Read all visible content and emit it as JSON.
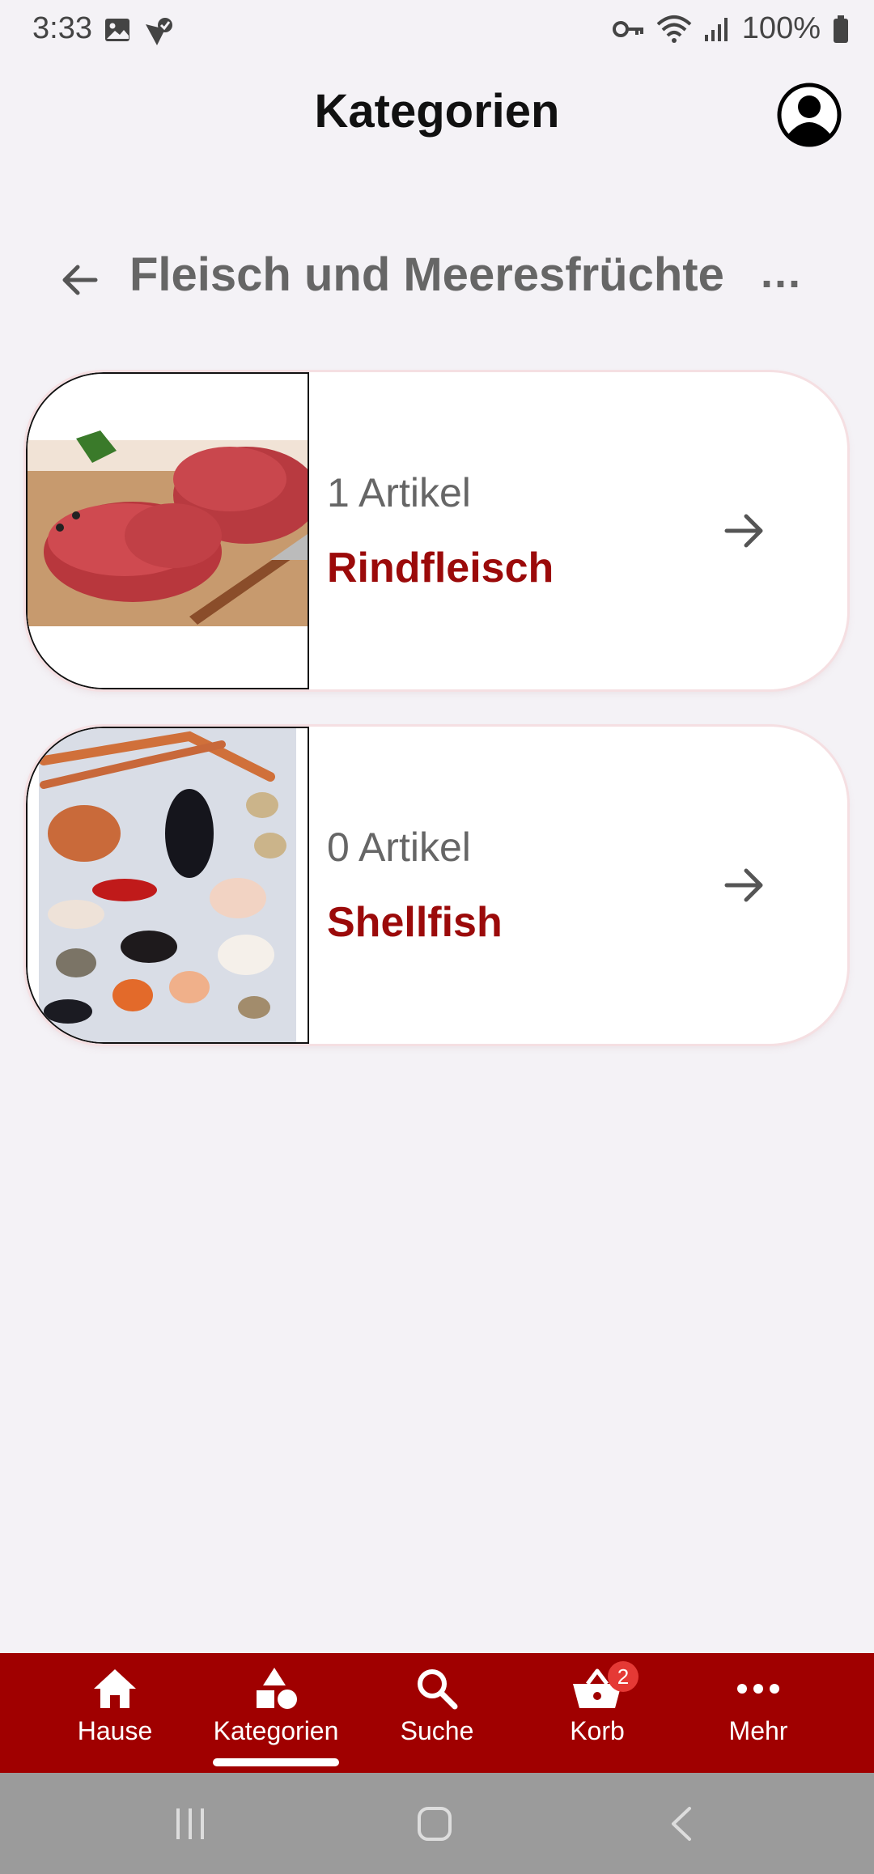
{
  "status_bar": {
    "time": "3:33",
    "battery": "100%"
  },
  "header": {
    "title": "Kategorien"
  },
  "sub_header": {
    "title": "Fleisch und Meeresfrüchte",
    "more": "..."
  },
  "categories": [
    {
      "count": "1 Artikel",
      "name": "Rindfleisch",
      "image": "beef-image"
    },
    {
      "count": "0 Artikel",
      "name": "Shellfish",
      "image": "shellfish-image"
    }
  ],
  "bottom_nav": {
    "active": "Kategorien",
    "items": [
      {
        "label": "Hause",
        "icon": "home-icon"
      },
      {
        "label": "Kategorien",
        "icon": "categories-icon"
      },
      {
        "label": "Suche",
        "icon": "search-icon"
      },
      {
        "label": "Korb",
        "icon": "basket-icon",
        "badge": "2"
      },
      {
        "label": "Mehr",
        "icon": "more-icon"
      }
    ]
  },
  "colors": {
    "brand": "#a00000",
    "category_name": "#9b0a0a",
    "background": "#f4f2f6",
    "badge": "#e53935"
  }
}
